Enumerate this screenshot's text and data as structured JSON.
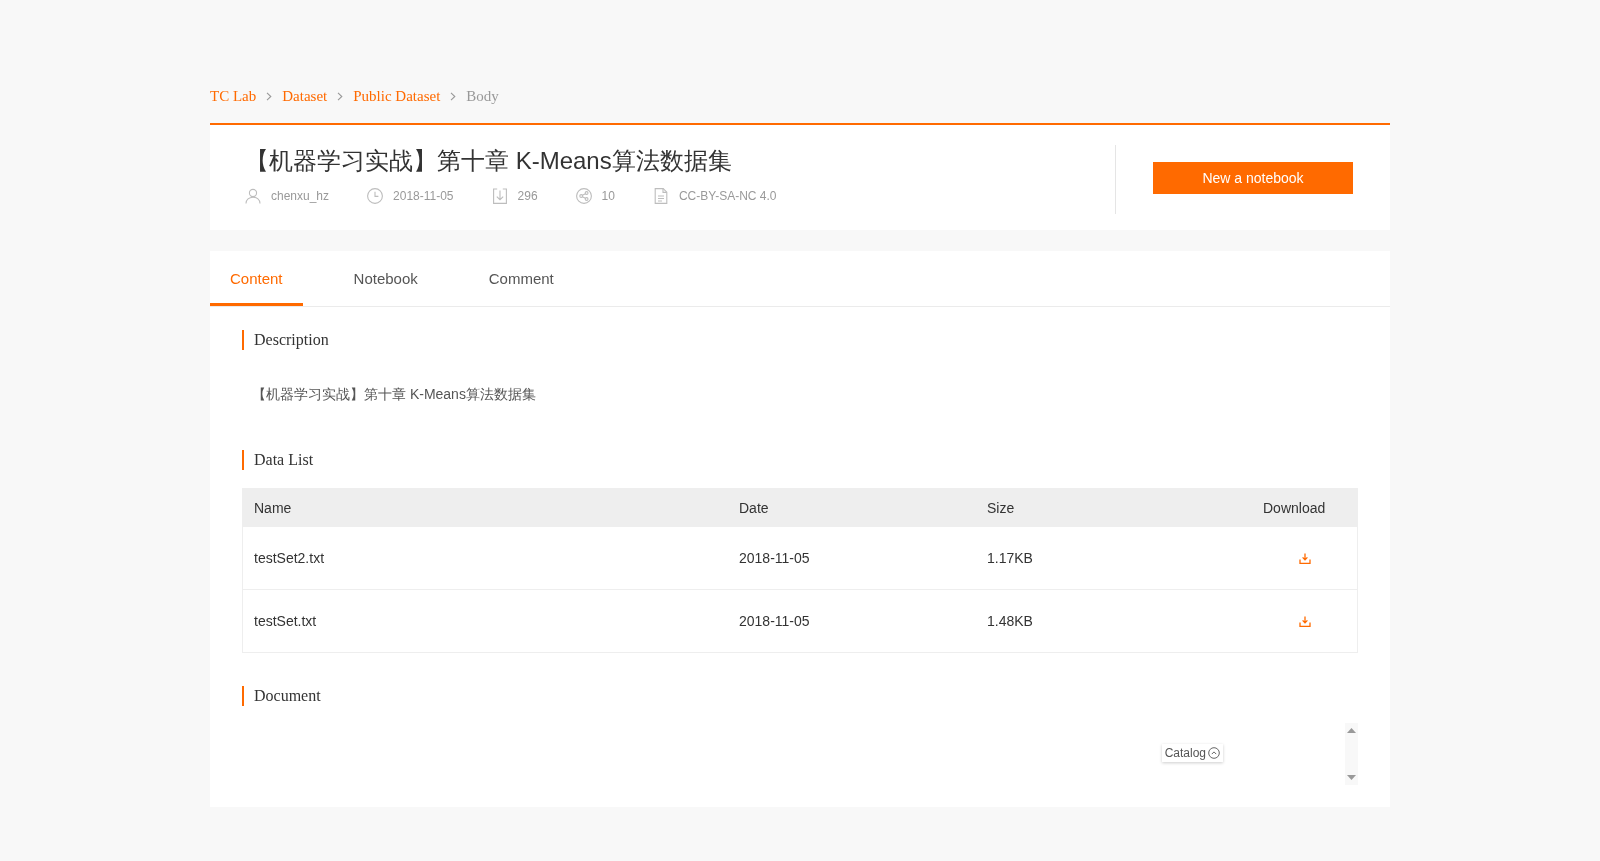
{
  "breadcrumb": [
    {
      "label": "TC Lab",
      "current": false
    },
    {
      "label": "Dataset",
      "current": false
    },
    {
      "label": "Public Dataset",
      "current": false
    },
    {
      "label": "Body",
      "current": true
    }
  ],
  "header": {
    "title": "【机器学习实战】第十章 K-Means算法数据集",
    "meta": [
      {
        "kind": "author",
        "text": "chenxu_hz"
      },
      {
        "kind": "date",
        "text": "2018-11-05"
      },
      {
        "kind": "downloads",
        "text": "296"
      },
      {
        "kind": "shares",
        "text": "10"
      },
      {
        "kind": "license",
        "text": "CC-BY-SA-NC 4.0"
      }
    ],
    "button": "New a notebook"
  },
  "tabs": [
    {
      "label": "Content",
      "selected": true
    },
    {
      "label": "Notebook",
      "selected": false
    },
    {
      "label": "Comment",
      "selected": false
    }
  ],
  "description": {
    "heading": "Description",
    "text": "【机器学习实战】第十章 K-Means算法数据集"
  },
  "data_list": {
    "heading": "Data List",
    "columns": [
      "Name",
      "Date",
      "Size",
      "Download"
    ],
    "rows": [
      {
        "name": "testSet2.txt",
        "date": "2018-11-05",
        "size": "1.17KB"
      },
      {
        "name": "testSet.txt",
        "date": "2018-11-05",
        "size": "1.48KB"
      }
    ]
  },
  "document": {
    "heading": "Document",
    "catalog": "Catalog"
  }
}
